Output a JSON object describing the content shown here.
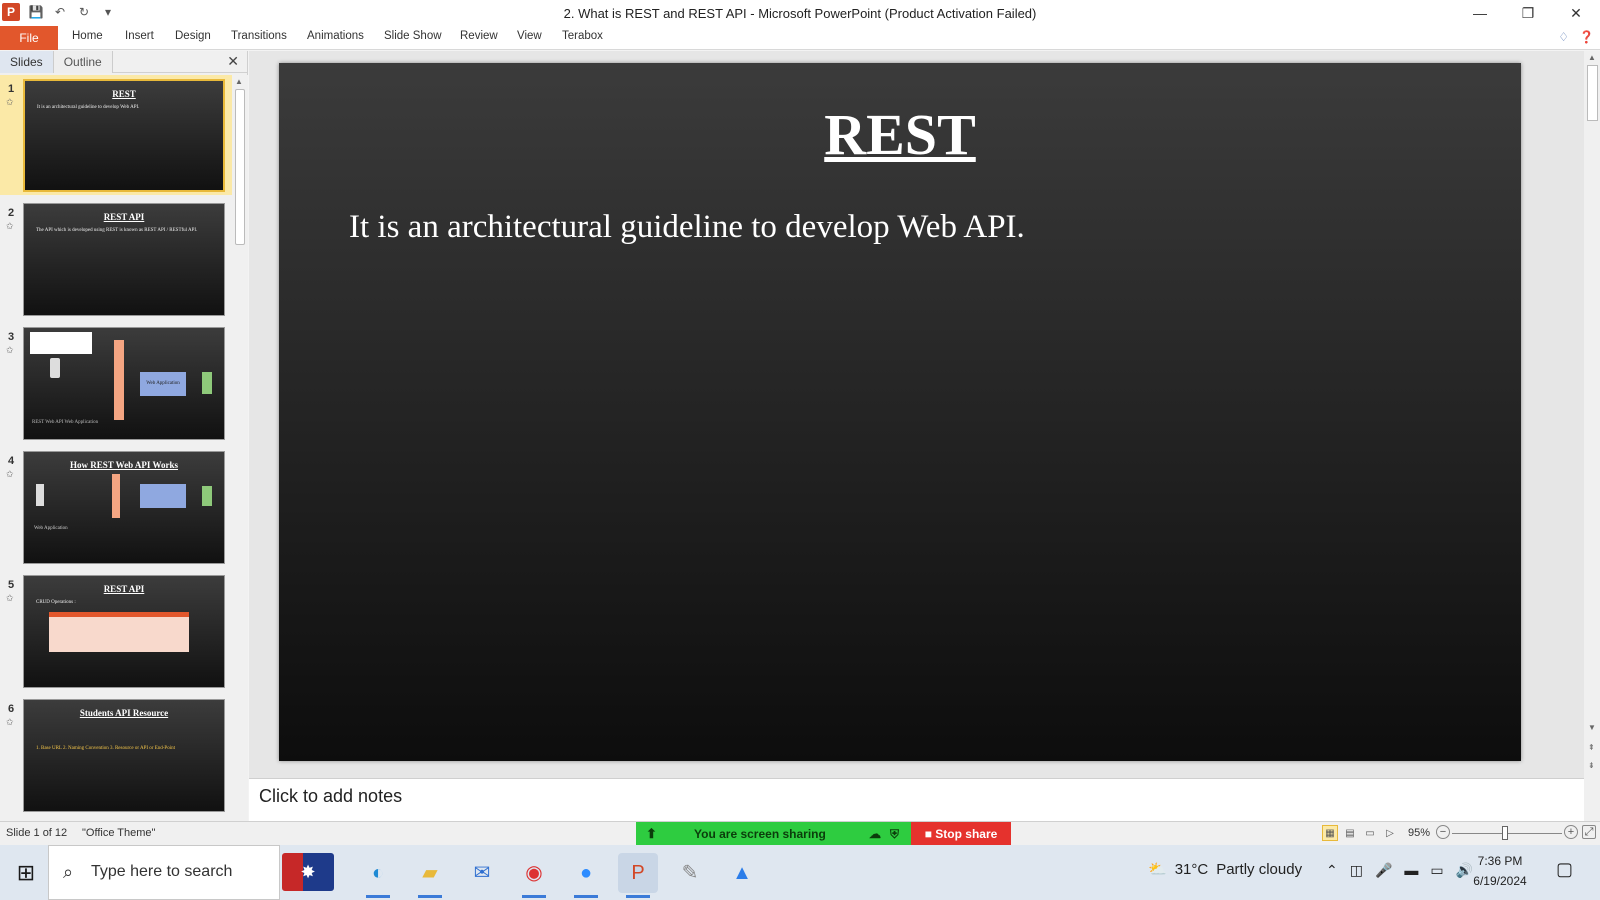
{
  "window": {
    "title": "2. What is REST and REST API  -  Microsoft PowerPoint (Product Activation Failed)",
    "controls": [
      "—",
      "❐",
      "✕"
    ]
  },
  "ribbon": {
    "file_label": "File",
    "tabs": [
      "Home",
      "Insert",
      "Design",
      "Transitions",
      "Animations",
      "Slide Show",
      "Review",
      "View",
      "Terabox"
    ]
  },
  "panel": {
    "tab_slides": "Slides",
    "tab_outline": "Outline"
  },
  "thumbnails": [
    {
      "num": "1",
      "title": "REST",
      "body": "It is an architectural guideline to develop Web API."
    },
    {
      "num": "2",
      "title": "REST API",
      "body": "The API which is developed using REST is known as REST API / RESTful API."
    },
    {
      "num": "3",
      "title": "",
      "body": "REST Web API   Web Application"
    },
    {
      "num": "4",
      "title": "How REST Web API Works",
      "body": "Web Application"
    },
    {
      "num": "5",
      "title": "REST API",
      "body": "CRUD Operations :"
    },
    {
      "num": "6",
      "title": "Students API Resource",
      "body": "1. Base URL  2. Naming Convention  3. Resource or API or End-Point"
    }
  ],
  "slide": {
    "title": "REST",
    "body": "It is an architectural guideline to develop  Web API."
  },
  "notes": {
    "placeholder": "Click to add notes"
  },
  "status": {
    "slide_info": "Slide 1 of 12",
    "theme": "\"Office Theme\"",
    "sharing_text": "You are screen sharing",
    "stop_share": "Stop share",
    "zoom": "95%",
    "zoom_fraction": 0.48
  },
  "taskbar": {
    "search_placeholder": "Type here to search",
    "weather_temp": "31°C",
    "weather_desc": "Partly cloudy",
    "time": "7:36 PM",
    "date": "6/19/2024"
  }
}
